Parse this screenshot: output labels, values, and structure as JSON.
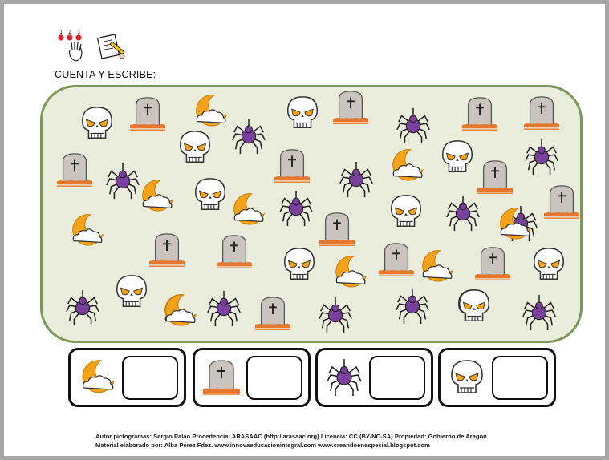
{
  "instruction": "CUENTA Y  ESCRIBE:",
  "counting_icon_numbers": [
    "1",
    "2",
    "3"
  ],
  "colors": {
    "board_fill": "#eaeddc",
    "board_border": "#7d9755",
    "moon": "#f5a21b",
    "cloud": "#ffffff",
    "spider": "#7b3f9e",
    "tombstone": "#c9c4bd",
    "grass": "#e8762c",
    "skull_eyes": "#f5a21b"
  },
  "items": [
    {
      "type": "skull"
    },
    {
      "type": "tombstone"
    },
    {
      "type": "moon"
    },
    {
      "type": "spider"
    },
    {
      "type": "tombstone"
    },
    {
      "type": "skull"
    },
    {
      "type": "tombstone"
    },
    {
      "type": "spider"
    },
    {
      "type": "tombstone"
    },
    {
      "type": "skull"
    },
    {
      "type": "tombstone"
    },
    {
      "type": "spider"
    },
    {
      "type": "moon"
    },
    {
      "type": "tombstone"
    },
    {
      "type": "spider"
    },
    {
      "type": "moon"
    },
    {
      "type": "skull"
    },
    {
      "type": "tombstone"
    },
    {
      "type": "spider"
    },
    {
      "type": "skull"
    },
    {
      "type": "spider"
    },
    {
      "type": "moon"
    },
    {
      "type": "skull"
    },
    {
      "type": "moon"
    },
    {
      "type": "spider"
    },
    {
      "type": "tombstone"
    },
    {
      "type": "skull"
    },
    {
      "type": "spider"
    },
    {
      "type": "moon"
    },
    {
      "type": "tombstone"
    },
    {
      "type": "moon"
    },
    {
      "type": "tombstone"
    },
    {
      "type": "tombstone"
    },
    {
      "type": "skull"
    },
    {
      "type": "moon"
    },
    {
      "type": "tombstone"
    },
    {
      "type": "moon"
    },
    {
      "type": "tombstone"
    },
    {
      "type": "skull"
    },
    {
      "type": "spider"
    },
    {
      "type": "skull"
    },
    {
      "type": "moon"
    },
    {
      "type": "spider"
    },
    {
      "type": "tombstone"
    },
    {
      "type": "spider"
    },
    {
      "type": "spider"
    },
    {
      "type": "skull"
    },
    {
      "type": "spider"
    }
  ],
  "answer_boxes": [
    {
      "icon": "moon",
      "answer": ""
    },
    {
      "icon": "tombstone",
      "answer": ""
    },
    {
      "icon": "spider",
      "answer": ""
    },
    {
      "icon": "skull",
      "answer": ""
    }
  ],
  "footer": {
    "line1_label_author": "Autor pictogramas:",
    "line1_author": "Sergio Palao",
    "line1_label_source": "Procedencia:",
    "line1_source": "ARASAAC (http://arasaac.org)",
    "line1_label_license": "Licencia:",
    "line1_license": "CC (BY-NC-SA)",
    "line1_label_owner": "Propiedad:",
    "line1_owner": "Gobierno de Aragón",
    "line2": "Material elaborado por: Alba Pérez Fdez.  www.innovaeducacionintegral.com www.creandoenespecial.blogspot.com"
  }
}
